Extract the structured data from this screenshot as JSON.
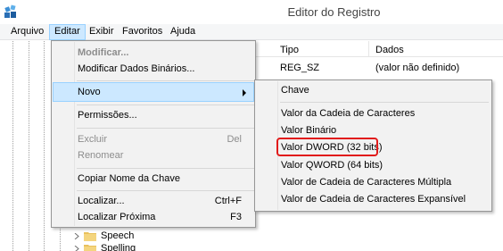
{
  "window": {
    "title": "Editor do Registro"
  },
  "menubar": {
    "items": [
      "Arquivo",
      "Editar",
      "Exibir",
      "Favoritos",
      "Ajuda"
    ]
  },
  "list": {
    "headers": {
      "type": "Tipo",
      "data": "Dados"
    },
    "rows": [
      {
        "type": "REG_SZ",
        "data": "(valor não definido)"
      }
    ]
  },
  "tree": {
    "items": [
      "Speech",
      "Spelling"
    ]
  },
  "edit_menu": {
    "modificar": "Modificar...",
    "modificar_binarios": "Modificar Dados Binários...",
    "novo": "Novo",
    "permissoes": "Permissões...",
    "excluir": "Excluir",
    "excluir_shortcut": "Del",
    "renomear": "Renomear",
    "copiar_nome": "Copiar Nome da Chave",
    "localizar": "Localizar...",
    "localizar_shortcut": "Ctrl+F",
    "localizar_proxima": "Localizar Próxima",
    "localizar_proxima_shortcut": "F3"
  },
  "new_submenu": {
    "chave": "Chave",
    "cadeia": "Valor da Cadeia de Caracteres",
    "binario": "Valor Binário",
    "dword": "Valor DWORD (32 bits)",
    "qword": "Valor QWORD (64 bits)",
    "multipla": "Valor de Cadeia de Caracteres Múltipla",
    "expansivel": "Valor de Cadeia de Caracteres Expansível"
  },
  "colors": {
    "highlight": "#91c9f7",
    "annotation": "#e11b1b"
  }
}
